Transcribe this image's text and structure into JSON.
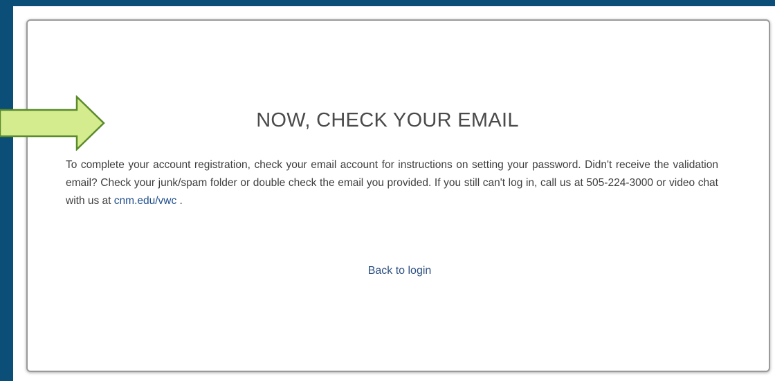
{
  "heading": "NOW, CHECK YOUR EMAIL",
  "message": {
    "text_before_link": "To complete your account registration, check your email account for instructions on setting your password. Didn't receive the validation email? Check your junk/spam folder or double check the email you provided. If you still can't log in, call us at 505-224-3000 or video chat with us at ",
    "link_text": "cnm.edu/vwc",
    "text_after_link": " ."
  },
  "back_to_login": "Back to login",
  "colors": {
    "frame": "#0b4f79",
    "arrow_fill": "#d4ec8e",
    "arrow_stroke": "#5a8a2a",
    "link": "#1f4e8c"
  },
  "icons": {
    "pointer_arrow": "right-arrow-icon"
  }
}
